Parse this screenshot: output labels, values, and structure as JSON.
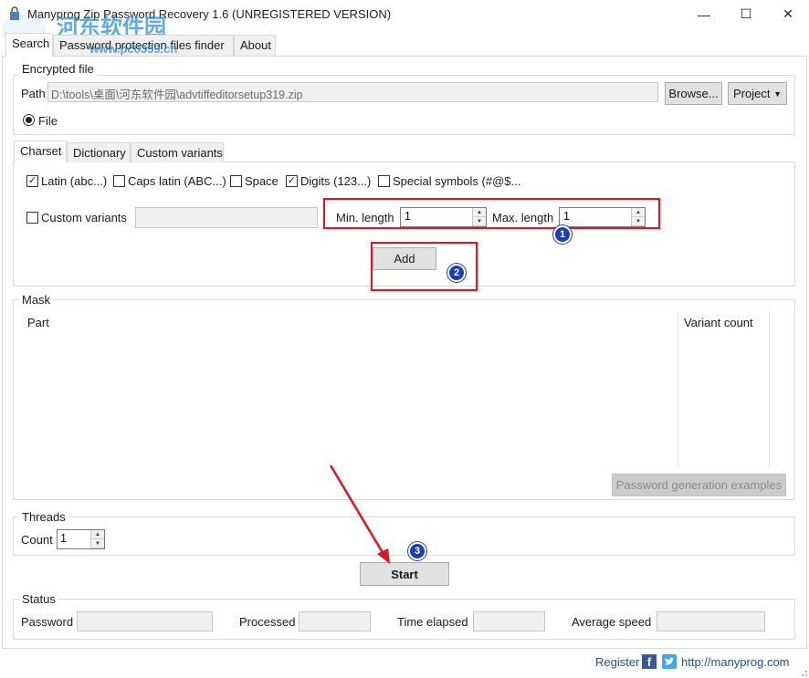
{
  "window": {
    "title": "Manyprog Zip Password Recovery 1.6 (UNREGISTERED VERSION)",
    "controls": {
      "minimize": "—",
      "maximize": "☐",
      "close": "✕"
    },
    "watermark_text": "河东软件园",
    "watermark_url": "www.pc0359.cn"
  },
  "tabs": [
    "Search",
    "Password protection files finder",
    "About"
  ],
  "encrypted_file": {
    "group_label": "Encrypted file",
    "path_label": "Path",
    "path_value": "D:\\tools\\桌面\\河东软件园\\advtiffeditorsetup319.zip",
    "browse_label": "Browse...",
    "project_label": "Project",
    "file_radio_label": "File"
  },
  "charset_tabs": [
    "Charset",
    "Dictionary",
    "Custom variants"
  ],
  "charset": {
    "latin": {
      "label": "Latin (abc...)",
      "checked": true
    },
    "caps": {
      "label": "Caps latin (ABC...)",
      "checked": false
    },
    "space": {
      "label": "Space",
      "checked": false
    },
    "digits": {
      "label": "Digits (123...)",
      "checked": true
    },
    "special": {
      "label": "Special symbols (#@$...",
      "checked": false
    },
    "custom": {
      "label": "Custom variants",
      "checked": false
    },
    "min_length_label": "Min. length",
    "min_length_value": "1",
    "max_length_label": "Max. length",
    "max_length_value": "1",
    "add_label": "Add"
  },
  "mask": {
    "group_label": "Mask",
    "col_part": "Part",
    "col_variant_count": "Variant count",
    "examples_label": "Password generation examples"
  },
  "threads": {
    "group_label": "Threads",
    "count_label": "Count",
    "count_value": "1"
  },
  "start_label": "Start",
  "status": {
    "group_label": "Status",
    "password_label": "Password",
    "processed_label": "Processed",
    "time_elapsed_label": "Time elapsed",
    "average_speed_label": "Average speed"
  },
  "footer": {
    "register_label": "Register",
    "facebook_icon": "f",
    "url": "http://manyprog.com"
  },
  "annotations": [
    "1",
    "2",
    "3"
  ],
  "colors": {
    "annotation_red": "#e0141e",
    "annotation_blue": "#1a3fb5",
    "link": "#1f4e9a"
  }
}
